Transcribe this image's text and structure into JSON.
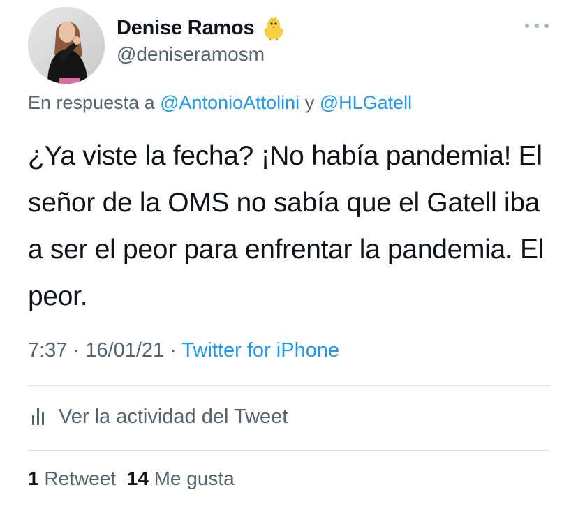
{
  "author": {
    "display_name": "Denise Ramos",
    "handle": "@deniseramosm",
    "avatar": "profile-photo"
  },
  "reply": {
    "prefix": "En respuesta a",
    "mention_1": "@AntonioAttolini",
    "conjunction": "y",
    "mention_2": "@HLGatell"
  },
  "tweet": {
    "text": "¿Ya viste la fecha? ¡No había pandemia! El señor de la OMS no sabía que el Gatell iba a ser el peor para enfrentar la pandemia. El peor.",
    "time": "7:37",
    "separator": "·",
    "date": "16/01/21",
    "source": "Twitter for iPhone"
  },
  "activity": {
    "label": "Ver la actividad del Tweet",
    "icon": "analytics-icon"
  },
  "stats": {
    "retweets_count": "1",
    "retweets_label": "Retweet",
    "likes_count": "14",
    "likes_label": "Me gusta"
  },
  "icons": {
    "emoji": "baby-chick-icon",
    "more": "more-icon"
  },
  "colors": {
    "link": "#1d9bf0",
    "secondary_text": "#536471",
    "primary_text": "#0f1419",
    "divider": "#dfe3e6"
  }
}
